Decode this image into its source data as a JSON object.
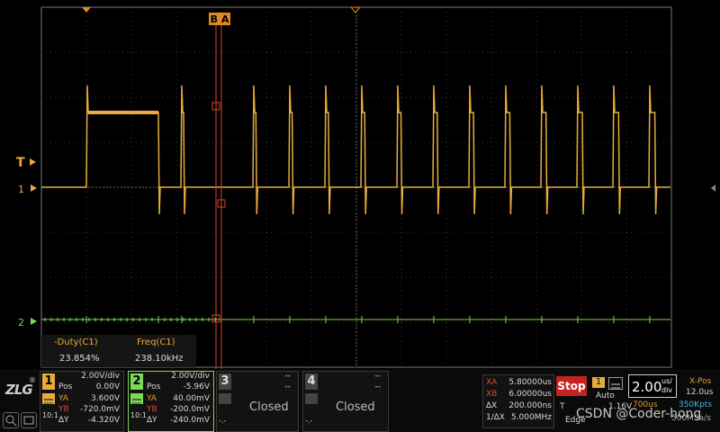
{
  "colors": {
    "ch1": "#e8ac3a",
    "ch2": "#7ed957",
    "cursor": "#d9442d",
    "grid": "#3a3a3a",
    "background": "#000000"
  },
  "markers": {
    "trigger_label": "T",
    "ch1_label": "1",
    "ch2_label": "2",
    "cursor_tag": "B A"
  },
  "measurements": {
    "headers": [
      "-Duty(C1)",
      "Freq(C1)"
    ],
    "values": [
      "23.854%",
      "238.10kHz"
    ]
  },
  "channels": [
    {
      "num": "1",
      "scale": "2.00V/div",
      "pos_label": "Pos",
      "pos": "0.00V",
      "ya_label": "YA",
      "ya": "3.600V",
      "yb_label": "YB",
      "yb": "-720.0mV",
      "dy_label": "∆Y",
      "dy": "-4.320V",
      "probe": "10:1"
    },
    {
      "num": "2",
      "scale": "2.00V/div",
      "pos_label": "Pos",
      "pos": "-5.96V",
      "ya_label": "YA",
      "ya": "40.00mV",
      "yb_label": "YB",
      "yb": "-200.0mV",
      "dy_label": "∆Y",
      "dy": "-240.0mV",
      "probe": "10:1"
    },
    {
      "num": "3",
      "scale": "--",
      "pos": "--",
      "status": "Closed",
      "dash": "-.-"
    },
    {
      "num": "4",
      "scale": "--",
      "pos": "--",
      "status": "Closed",
      "dash": "-.-"
    }
  ],
  "cursors": {
    "xa_label": "XA",
    "xa": "5.80000us",
    "xb_label": "XB",
    "xb": "6.00000us",
    "dx_label": "∆X",
    "dx": "200.000ns",
    "inv_label": "1/∆X",
    "inv": "5.000MHz"
  },
  "run": {
    "state": "Stop"
  },
  "trigger": {
    "source": "1",
    "mode": "Auto",
    "label": "T",
    "level": "1.16V",
    "type": "Edge"
  },
  "timebase": {
    "value": "2.00",
    "unit_top": "us/",
    "unit_bottom": "div",
    "delay": "700us",
    "xpos_label": "X-Pos",
    "xpos": "12.0us",
    "sample_rate": "350Kpts",
    "memory": "500MSa/s"
  },
  "watermark": "CSDN @Coder-hong",
  "logo": "ZLG"
}
